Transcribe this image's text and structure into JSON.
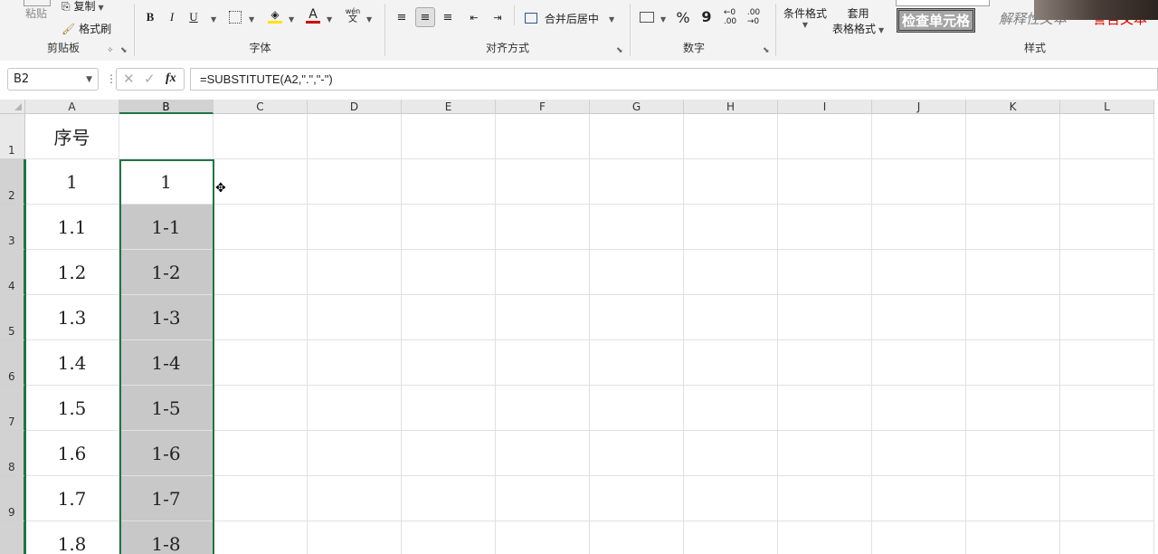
{
  "ribbon": {
    "clipboard": {
      "paste_label": "粘贴",
      "copy_label": "复制",
      "format_painter_label": "格式刷",
      "group_label": "剪贴板"
    },
    "font": {
      "bold": "B",
      "italic": "I",
      "underline": "U",
      "font_color_glyph": "A",
      "phonetic_glyph": "wén",
      "group_label": "字体"
    },
    "alignment": {
      "merge_center_label": "合并后居中",
      "group_label": "对齐方式"
    },
    "number": {
      "percent": "%",
      "comma": "9",
      "group_label": "数字"
    },
    "styles": {
      "conditional_format_label": "条件格式",
      "table_format_line1": "套用",
      "table_format_line2": "表格格式",
      "check_cell": "检查单元格",
      "explanatory_text": "解释性文本",
      "warning_text": "警告文本",
      "group_label": "样式"
    }
  },
  "formula_bar": {
    "name_box": "B2",
    "fx": "fx",
    "formula": "=SUBSTITUTE(A2,\".\",\"-\")"
  },
  "grid": {
    "columns": [
      "A",
      "B",
      "C",
      "D",
      "E",
      "F",
      "G",
      "H",
      "I",
      "J",
      "K",
      "L"
    ],
    "rows": [
      "1",
      "2",
      "3",
      "4",
      "5",
      "6",
      "7",
      "8",
      "9"
    ],
    "col_a": [
      "序号",
      "1",
      "1.1",
      "1.2",
      "1.3",
      "1.4",
      "1.5",
      "1.6",
      "1.7",
      "1.8"
    ],
    "col_b": [
      "",
      "1",
      "1-1",
      "1-2",
      "1-3",
      "1-4",
      "1-5",
      "1-6",
      "1-7",
      "1-8"
    ]
  },
  "colors": {
    "selection_border": "#217346",
    "selection_fill": "#c8c8c8",
    "font_color_red": "#d00000",
    "highlight_yellow": "#ffe400"
  }
}
